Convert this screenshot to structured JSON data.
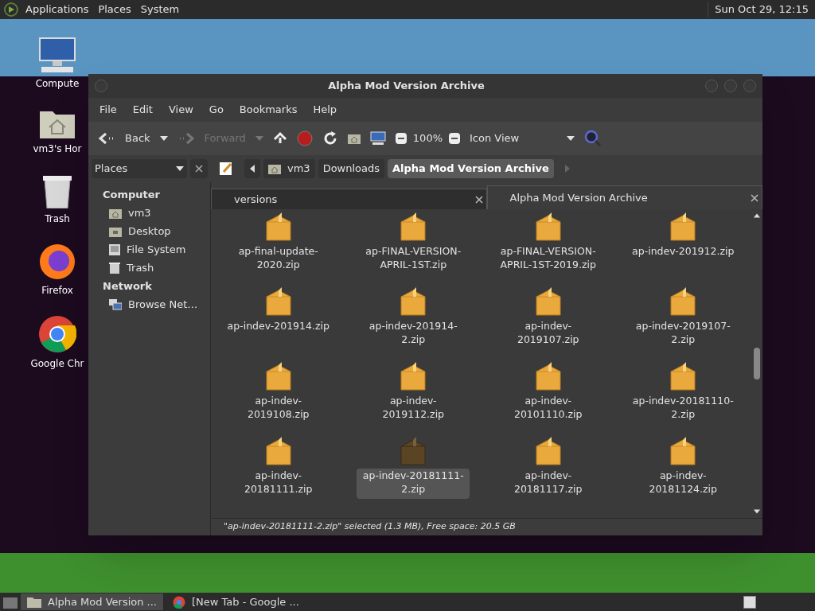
{
  "top_panel": {
    "menus": [
      "Applications",
      "Places",
      "System"
    ],
    "clock": "Sun Oct 29, 12:15"
  },
  "desktop_icons": [
    {
      "kind": "computer",
      "label": "Compute"
    },
    {
      "kind": "home",
      "label": "vm3's Hor"
    },
    {
      "kind": "trash",
      "label": "Trash"
    },
    {
      "kind": "firefox",
      "label": "Firefox"
    },
    {
      "kind": "chrome",
      "label": "Google Chr"
    }
  ],
  "window": {
    "title": "Alpha Mod Version Archive",
    "menu": [
      "File",
      "Edit",
      "View",
      "Go",
      "Bookmarks",
      "Help"
    ],
    "toolbar": {
      "back": {
        "label": "Back",
        "disabled": false
      },
      "forward": {
        "label": "Forward",
        "disabled": true
      },
      "zoom": "100%",
      "view": "Icon View"
    },
    "sidebar": {
      "title": "Places",
      "sections": [
        {
          "heading": "Computer",
          "items": [
            {
              "kind": "home",
              "label": "vm3"
            },
            {
              "kind": "desktop",
              "label": "Desktop"
            },
            {
              "kind": "drive",
              "label": "File System"
            },
            {
              "kind": "trash",
              "label": "Trash"
            }
          ]
        },
        {
          "heading": "Network",
          "items": [
            {
              "kind": "network",
              "label": "Browse Net…"
            }
          ]
        }
      ]
    },
    "breadcrumb": [
      {
        "label": "vm3",
        "selected": false
      },
      {
        "label": "Downloads",
        "selected": false
      },
      {
        "label": "Alpha Mod Version Archive",
        "selected": true
      }
    ],
    "tabs": [
      {
        "label": "versions",
        "selected": false
      },
      {
        "label": "Alpha Mod Version Archive",
        "selected": true
      }
    ],
    "files": [
      {
        "name": "ap-final-update-2020.zip",
        "selected": false
      },
      {
        "name": "ap-FINAL-VERSION-APRIL-1ST.zip",
        "selected": false
      },
      {
        "name": "ap-FINAL-VERSION-APRIL-1ST-2019.zip",
        "selected": false
      },
      {
        "name": "ap-indev-201912.zip",
        "selected": false
      },
      {
        "name": "ap-indev-201914.zip",
        "selected": false
      },
      {
        "name": "ap-indev-201914-2.zip",
        "selected": false
      },
      {
        "name": "ap-indev-2019107.zip",
        "selected": false
      },
      {
        "name": "ap-indev-2019107-2.zip",
        "selected": false
      },
      {
        "name": "ap-indev-2019108.zip",
        "selected": false
      },
      {
        "name": "ap-indev-2019112.zip",
        "selected": false
      },
      {
        "name": "ap-indev-20101110.zip",
        "selected": false
      },
      {
        "name": "ap-indev-20181110-2.zip",
        "selected": false
      },
      {
        "name": "ap-indev-20181111.zip",
        "selected": false
      },
      {
        "name": "ap-indev-20181111-2.zip",
        "selected": true
      },
      {
        "name": "ap-indev-20181117.zip",
        "selected": false
      },
      {
        "name": "ap-indev-20181124.zip",
        "selected": false
      }
    ],
    "status": "\"ap-indev-20181111-2.zip\" selected (1.3 MB), Free space: 20.5 GB"
  },
  "taskbar": [
    {
      "kind": "folder",
      "label": "Alpha Mod Version ...",
      "selected": true
    },
    {
      "kind": "chrome",
      "label": "[New Tab - Google ...",
      "selected": false
    }
  ]
}
